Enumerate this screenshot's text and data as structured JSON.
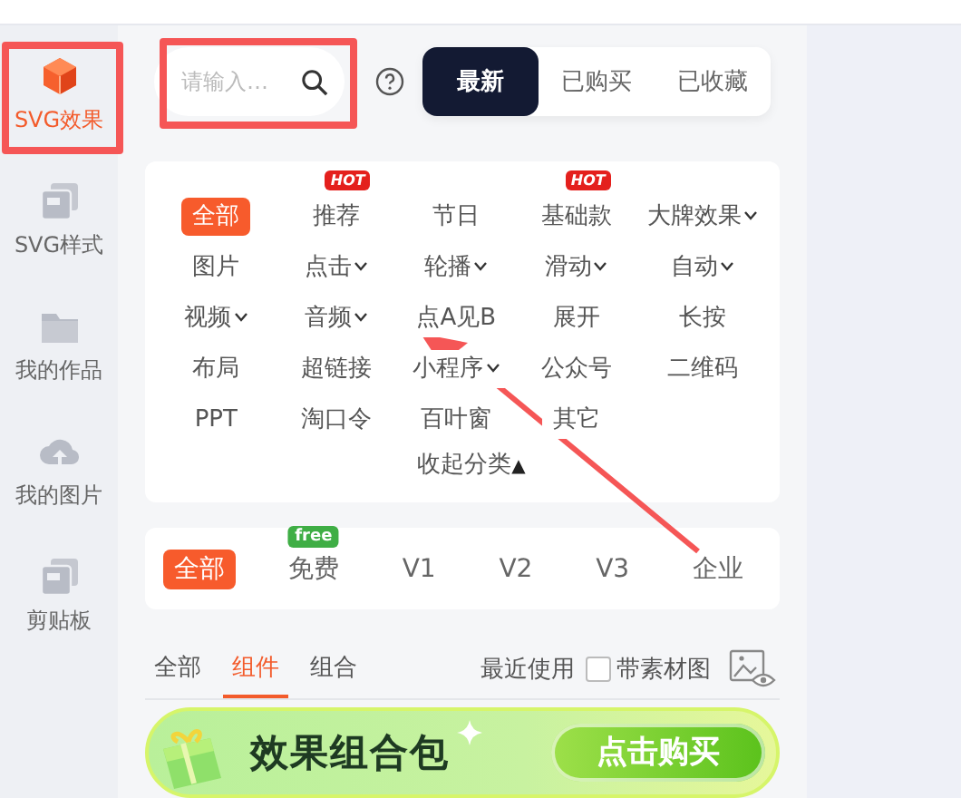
{
  "sidebar": {
    "items": [
      {
        "label": "SVG效果",
        "selected": true
      },
      {
        "label": "SVG样式",
        "selected": false
      },
      {
        "label": "我的作品",
        "selected": false
      },
      {
        "label": "我的图片",
        "selected": false
      },
      {
        "label": "剪贴板",
        "selected": false
      }
    ]
  },
  "search": {
    "placeholder": "请输入…"
  },
  "filter_tabs": [
    {
      "label": "最新",
      "selected": true
    },
    {
      "label": "已购买",
      "selected": false
    },
    {
      "label": "已收藏",
      "selected": false
    }
  ],
  "categories": {
    "items": [
      {
        "label": "全部",
        "selected": true,
        "dropdown": false
      },
      {
        "label": "推荐",
        "selected": false,
        "dropdown": false,
        "badge": "HOT"
      },
      {
        "label": "节日",
        "selected": false,
        "dropdown": false
      },
      {
        "label": "基础款",
        "selected": false,
        "dropdown": false,
        "badge": "HOT"
      },
      {
        "label": "大牌效果",
        "selected": false,
        "dropdown": true
      },
      {
        "label": "图片",
        "selected": false,
        "dropdown": false
      },
      {
        "label": "点击",
        "selected": false,
        "dropdown": true
      },
      {
        "label": "轮播",
        "selected": false,
        "dropdown": true
      },
      {
        "label": "滑动",
        "selected": false,
        "dropdown": true
      },
      {
        "label": "自动",
        "selected": false,
        "dropdown": true
      },
      {
        "label": "视频",
        "selected": false,
        "dropdown": true
      },
      {
        "label": "音频",
        "selected": false,
        "dropdown": true
      },
      {
        "label": "点A见B",
        "selected": false,
        "dropdown": false
      },
      {
        "label": "展开",
        "selected": false,
        "dropdown": false
      },
      {
        "label": "长按",
        "selected": false,
        "dropdown": false
      },
      {
        "label": "布局",
        "selected": false,
        "dropdown": false
      },
      {
        "label": "超链接",
        "selected": false,
        "dropdown": false
      },
      {
        "label": "小程序",
        "selected": false,
        "dropdown": true
      },
      {
        "label": "公众号",
        "selected": false,
        "dropdown": false
      },
      {
        "label": "二维码",
        "selected": false,
        "dropdown": false
      },
      {
        "label": "PPT",
        "selected": false,
        "dropdown": false
      },
      {
        "label": "淘口令",
        "selected": false,
        "dropdown": false
      },
      {
        "label": "百叶窗",
        "selected": false,
        "dropdown": false
      },
      {
        "label": "其它",
        "selected": false,
        "dropdown": false
      }
    ],
    "collapse": {
      "label": "收起分类",
      "arrow": "▲"
    }
  },
  "versions": [
    {
      "label": "全部",
      "selected": true
    },
    {
      "label": "免费",
      "selected": false,
      "badge": "free"
    },
    {
      "label": "V1",
      "selected": false
    },
    {
      "label": "V2",
      "selected": false
    },
    {
      "label": "V3",
      "selected": false
    },
    {
      "label": "企业",
      "selected": false
    }
  ],
  "type_tabs": [
    {
      "label": "全部",
      "selected": false
    },
    {
      "label": "组件",
      "selected": true
    },
    {
      "label": "组合",
      "selected": false
    }
  ],
  "recent": {
    "label": "最近使用"
  },
  "with_material": {
    "label": "带素材图",
    "checked": false
  },
  "banner": {
    "title": "效果组合包",
    "button": "点击购买"
  },
  "annotations": [
    {
      "kind": "box"
    },
    {
      "kind": "box"
    },
    {
      "kind": "arrow"
    }
  ]
}
